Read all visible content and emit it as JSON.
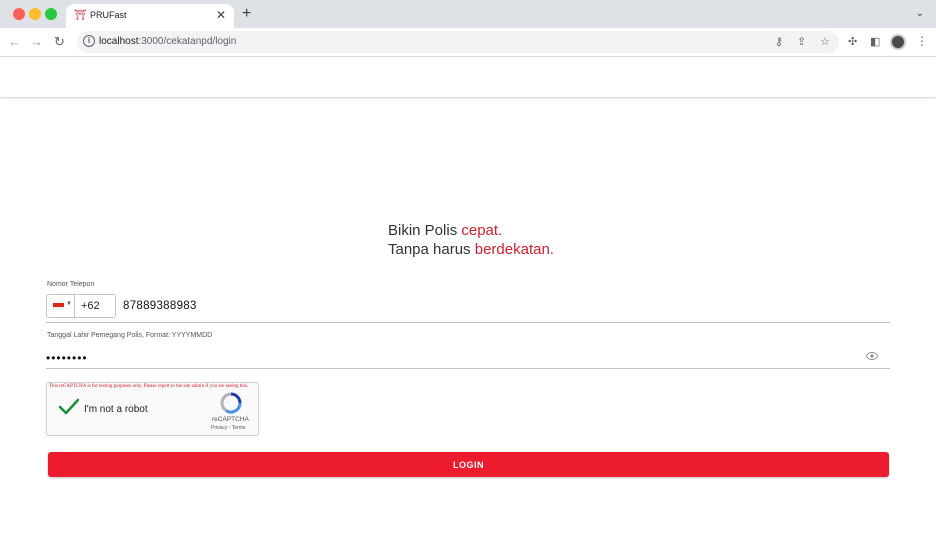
{
  "browser": {
    "tab_title": "PRUFast",
    "tab_favicon": "pru-logo-icon",
    "tab_close": "✕",
    "new_tab": "+",
    "url_host": "localhost",
    "url_rest": ":3000/cekatanpd/login",
    "icons": [
      "back-arrow-icon",
      "forward-arrow-icon",
      "reload-icon",
      "info-icon",
      "key-icon",
      "share-icon",
      "star-icon",
      "extensions-icon",
      "side-panel-icon",
      "profile-avatar",
      "kebab-menu-icon"
    ]
  },
  "tagline": {
    "line1_prefix": "Bikin Polis ",
    "line1_accent": "cepat.",
    "line2_prefix": "Tanpa harus ",
    "line2_accent": "berdekatan."
  },
  "form": {
    "phone_label": "Nomor Telepon",
    "country_flag": "indonesia-flag",
    "dial_code": "+62",
    "phone_value": "87889388983",
    "dob_label": "Tanggal Lahir Pemegang Polis, Format: YYYYMMDD",
    "password_value": "••••••••",
    "toggle_visibility_icon": "eye-icon"
  },
  "captcha": {
    "warning": "This reCAPTCHA is for testing purposes only. Please report to the site admin if you are seeing this.",
    "label": "I'm not a robot",
    "checked": true,
    "brand": "reCAPTCHA",
    "links": "Privacy - Terms"
  },
  "login_button": "LOGIN",
  "colors": {
    "brand_red": "#ed1b2e",
    "accent_text": "#d0202e"
  }
}
